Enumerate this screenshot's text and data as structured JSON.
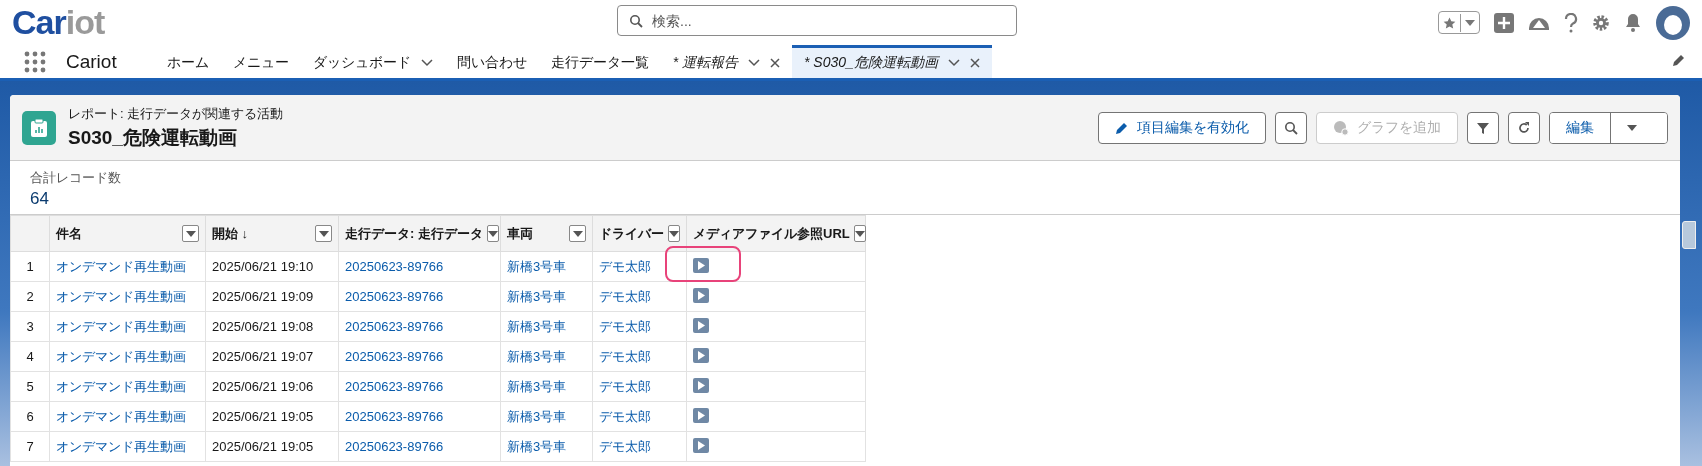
{
  "header": {
    "logo": [
      "Car",
      "iot"
    ],
    "search": {
      "placeholder": "検索..."
    }
  },
  "nav": {
    "app_name": "Cariot",
    "tabs": [
      {
        "label": "ホーム",
        "kind": "plain",
        "selected": false
      },
      {
        "label": "メニュー",
        "kind": "plain",
        "selected": false
      },
      {
        "label": "ダッシュボード",
        "kind": "menu",
        "selected": false
      },
      {
        "label": "問い合わせ",
        "kind": "plain",
        "selected": false
      },
      {
        "label": "走行データ一覧",
        "kind": "plain",
        "selected": false
      },
      {
        "label": "* 運転報告",
        "kind": "record",
        "selected": false
      },
      {
        "label": "* S030_危険運転動画",
        "kind": "record",
        "selected": true
      }
    ]
  },
  "report": {
    "type_label": "レポート: 走行データが関連する活動",
    "title": "S030_危険運転動画",
    "buttons": [
      {
        "label": "項目編集を有効化",
        "kind": "pencil",
        "disabled": false
      },
      {
        "kind": "search",
        "disabled": false
      },
      {
        "label": "グラフを追加",
        "kind": "chart",
        "disabled": true
      },
      {
        "kind": "filter",
        "disabled": false
      },
      {
        "kind": "refresh",
        "disabled": false
      },
      {
        "label": "編集",
        "kind": "split",
        "disabled": false
      }
    ]
  },
  "summary": {
    "label": "合計レコード数",
    "value": "64"
  },
  "table": {
    "columns": [
      {
        "label": "件名",
        "kind": "link"
      },
      {
        "label": "開始 ↓",
        "kind": "text"
      },
      {
        "label": "走行データ: 走行データ",
        "kind": "link"
      },
      {
        "label": "車両",
        "kind": "link"
      },
      {
        "label": "ドライバー",
        "kind": "link"
      },
      {
        "label": "メディアファイル参照URL",
        "kind": "media"
      }
    ],
    "rows": [
      {
        "number": "1",
        "highlighted": true,
        "cells": [
          "オンデマンド再生動画",
          "2025/06/21 19:10",
          "20250623-89766",
          "新橋3号車",
          "デモ太郎"
        ]
      },
      {
        "number": "2",
        "highlighted": false,
        "cells": [
          "オンデマンド再生動画",
          "2025/06/21 19:09",
          "20250623-89766",
          "新橋3号車",
          "デモ太郎"
        ]
      },
      {
        "number": "3",
        "highlighted": false,
        "cells": [
          "オンデマンド再生動画",
          "2025/06/21 19:08",
          "20250623-89766",
          "新橋3号車",
          "デモ太郎"
        ]
      },
      {
        "number": "4",
        "highlighted": false,
        "cells": [
          "オンデマンド再生動画",
          "2025/06/21 19:07",
          "20250623-89766",
          "新橋3号車",
          "デモ太郎"
        ]
      },
      {
        "number": "5",
        "highlighted": false,
        "cells": [
          "オンデマンド再生動画",
          "2025/06/21 19:06",
          "20250623-89766",
          "新橋3号車",
          "デモ太郎"
        ]
      },
      {
        "number": "6",
        "highlighted": false,
        "cells": [
          "オンデマンド再生動画",
          "2025/06/21 19:05",
          "20250623-89766",
          "新橋3号車",
          "デモ太郎"
        ]
      },
      {
        "number": "7",
        "highlighted": false,
        "cells": [
          "オンデマンド再生動画",
          "2025/06/21 19:05",
          "20250623-89766",
          "新橋3号車",
          "デモ太郎"
        ]
      }
    ]
  }
}
